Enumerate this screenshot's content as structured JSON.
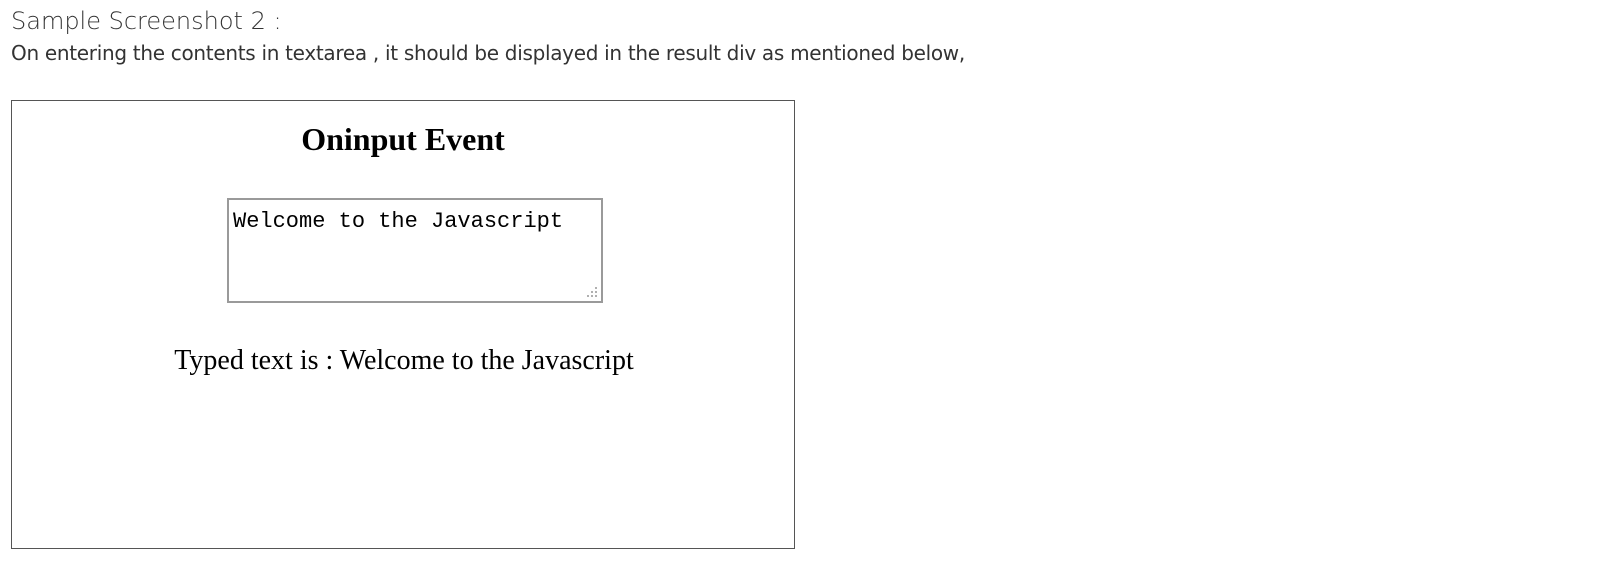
{
  "page": {
    "heading": "Sample Screenshot 2 :",
    "description": "On entering the contents in textarea , it should be displayed in the result div as mentioned below,"
  },
  "demo": {
    "title": "Oninput Event",
    "textarea_value": "Welcome to the Javascript",
    "result_label": "Typed text is : ",
    "result_value": "Welcome to the Javascript"
  },
  "colors": {
    "frame_border": "#555555",
    "textarea_border": "#9a9a9a",
    "body_text": "#333333"
  }
}
